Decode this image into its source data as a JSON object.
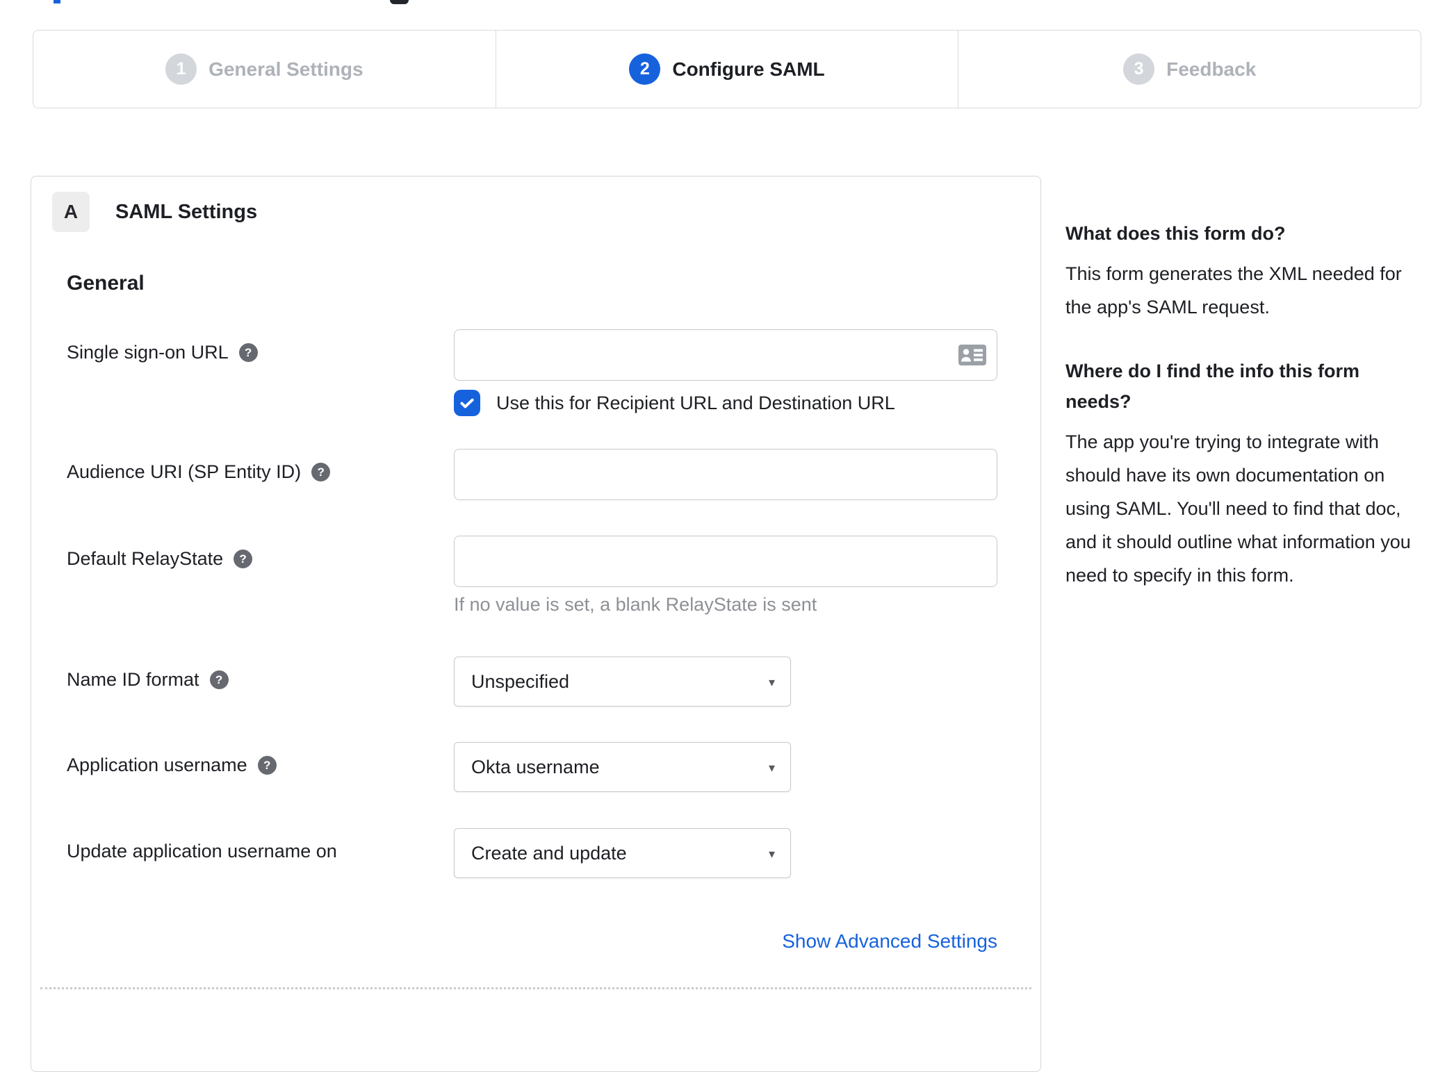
{
  "wizard": {
    "steps": [
      {
        "number": "1",
        "label": "General Settings",
        "state": "inactive"
      },
      {
        "number": "2",
        "label": "Configure SAML",
        "state": "active"
      },
      {
        "number": "3",
        "label": "Feedback",
        "state": "inactive"
      }
    ]
  },
  "panel": {
    "section_badge": "A",
    "section_title": "SAML Settings",
    "group_title": "General",
    "fields": {
      "sso": {
        "label": "Single sign-on URL",
        "value": ""
      },
      "sso_checkbox": {
        "label": "Use this for Recipient URL and Destination URL",
        "checked": true
      },
      "audience": {
        "label": "Audience URI (SP Entity ID)",
        "value": ""
      },
      "relay_state": {
        "label": "Default RelayState",
        "value": "",
        "hint": "If no value is set, a blank RelayState is sent"
      },
      "name_id_format": {
        "label": "Name ID format",
        "value": "Unspecified"
      },
      "app_username": {
        "label": "Application username",
        "value": "Okta username"
      },
      "update_app_username": {
        "label": "Update application username on",
        "value": "Create and update"
      }
    },
    "advanced_link": "Show Advanced Settings"
  },
  "sidebar": {
    "sections": [
      {
        "heading": "What does this form do?",
        "body": "This form generates the XML needed for the app's SAML request."
      },
      {
        "heading": "Where do I find the info this form needs?",
        "body": "The app you're trying to integrate with should have its own documentation on using SAML. You'll need to find that doc, and it should outline what information you need to specify in this form."
      }
    ]
  },
  "icons": {
    "help": "?",
    "caret": "▾"
  },
  "colors": {
    "accent": "#1662dd",
    "text": "#1d1f24",
    "inactive": "#aeb2b8",
    "border": "#d4d6da",
    "hint": "#8d9095"
  }
}
